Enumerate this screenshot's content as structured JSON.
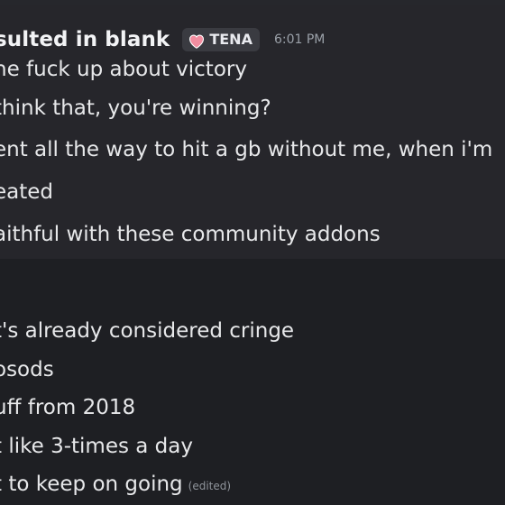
{
  "message_block_1": {
    "author": "sulted in blank",
    "role_tag": "TENA",
    "timestamp": "6:01 PM",
    "lines": [
      "he fuck up about victory",
      "think that, you're winning?",
      "ent all the way to hit a gb without me, when i'm",
      "eated",
      "aithful with these community addons"
    ]
  },
  "message_block_2": {
    "lines": [
      "t's already considered cringe",
      "osods",
      "uff from 2018",
      "t like 3-times a day",
      "t to keep on going"
    ],
    "edited_label": "(edited)"
  },
  "icons": {
    "role_heart": "heart-icon"
  },
  "colors": {
    "background_top": "#26262b",
    "background_bottom": "#1e1f23",
    "role_tag_bg": "#3a3b41",
    "heart_icon": "#f28da0",
    "timestamp": "#9aa0a8"
  }
}
